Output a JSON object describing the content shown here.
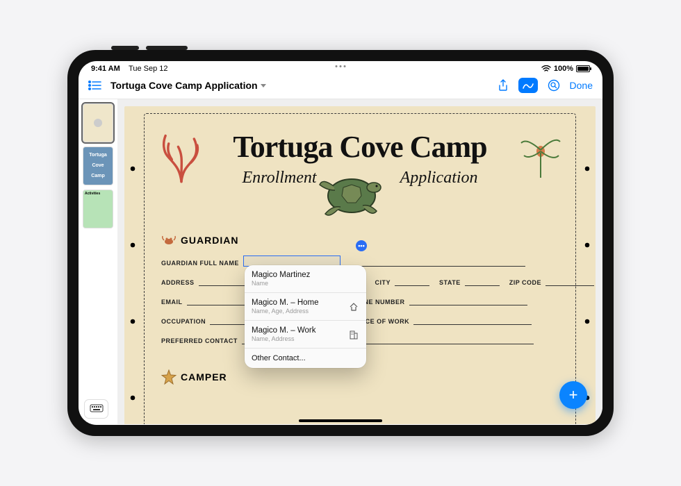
{
  "status": {
    "time": "9:41 AM",
    "date": "Tue Sep 12",
    "battery": "100%"
  },
  "toolbar": {
    "title": "Tortuga Cove Camp Application",
    "done": "Done"
  },
  "thumbnails": {
    "t2_line1": "Tortuga",
    "t2_line2": "Cove",
    "t2_line3": "Camp",
    "t3": "Activities"
  },
  "document": {
    "title": "Tortuga Cove Camp",
    "subtitle_left": "Enrollment",
    "subtitle_right": "Application",
    "section_guardian": "GUARDIAN",
    "section_camper": "CAMPER",
    "labels": {
      "full_name": "GUARDIAN FULL NAME",
      "address": "ADDRESS",
      "city": "CITY",
      "state": "STATE",
      "zip": "ZIP CODE",
      "email": "EMAIL",
      "phone": "PHONE NUMBER",
      "occupation": "OCCUPATION",
      "workplace": "PLACE OF WORK",
      "preferred": "PREFERRED CONTACT"
    }
  },
  "autofill": {
    "items": [
      {
        "name": "Magico Martinez",
        "sub": "Name",
        "icon": ""
      },
      {
        "name": "Magico M. – Home",
        "sub": "Name, Age, Address",
        "icon": "home"
      },
      {
        "name": "Magico M. – Work",
        "sub": "Name, Address",
        "icon": "building"
      }
    ],
    "other": "Other Contact..."
  }
}
